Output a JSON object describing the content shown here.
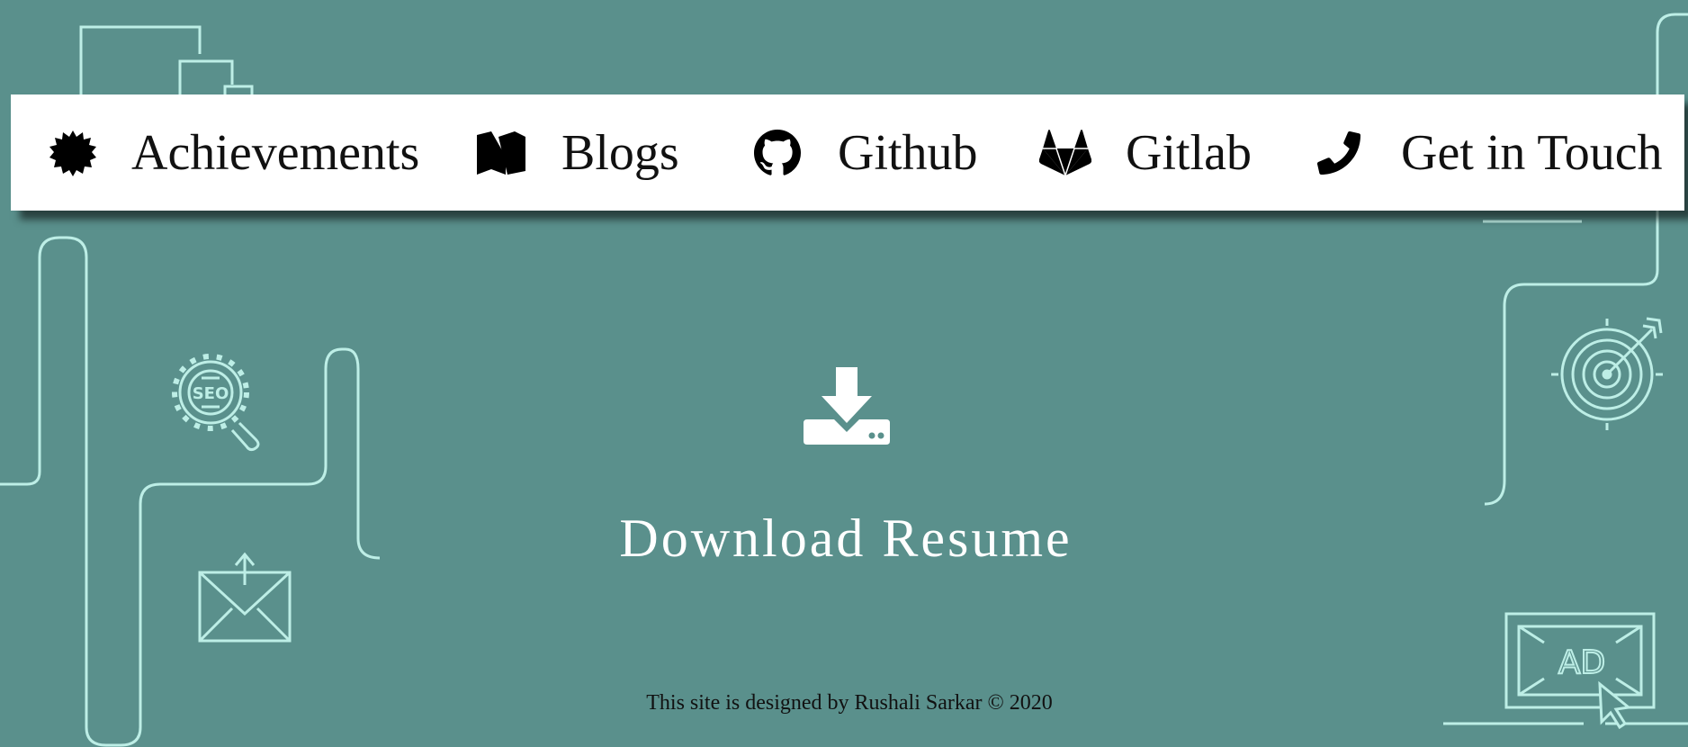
{
  "colors": {
    "background": "#5a908c",
    "line_art": "#bdeee6",
    "nav_bg": "#ffffff",
    "nav_text": "#111111",
    "download_text": "#ffffff"
  },
  "nav": {
    "items": [
      {
        "label": "Achievements",
        "icon": "badge-icon"
      },
      {
        "label": "Blogs",
        "icon": "medium-icon"
      },
      {
        "label": "Github",
        "icon": "github-icon"
      },
      {
        "label": "Gitlab",
        "icon": "gitlab-icon"
      },
      {
        "label": "Get in Touch",
        "icon": "phone-icon"
      }
    ]
  },
  "download": {
    "label": "Download Resume",
    "icon": "download-icon"
  },
  "footer": {
    "text": "This site is designed by Rushali Sarkar © 2020"
  },
  "decorations": {
    "seo_icon_text": "SEO",
    "ad_icon_text": "AD"
  }
}
